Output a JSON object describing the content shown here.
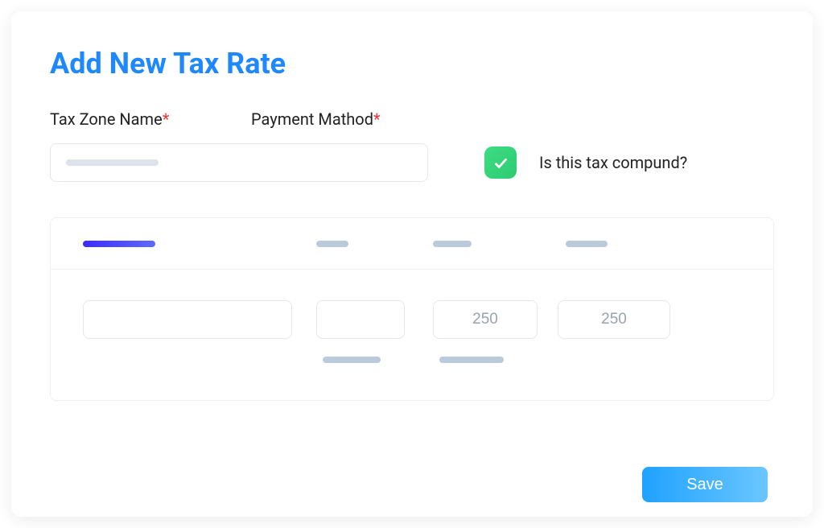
{
  "title": "Add New Tax Rate",
  "fields": {
    "tax_zone_name": {
      "label": "Tax Zone Name",
      "value": "",
      "required": true
    },
    "payment_method": {
      "label": "Payment Mathod",
      "required": true
    }
  },
  "compound": {
    "label": "Is this tax compund?",
    "checked": true
  },
  "table": {
    "row": {
      "col1_value": "",
      "col2_value": "",
      "col3_value": "250",
      "col4_value": "250"
    }
  },
  "buttons": {
    "save": "Save"
  },
  "colors": {
    "accent": "#1E88FF",
    "checkbox": "#2ECC71"
  }
}
